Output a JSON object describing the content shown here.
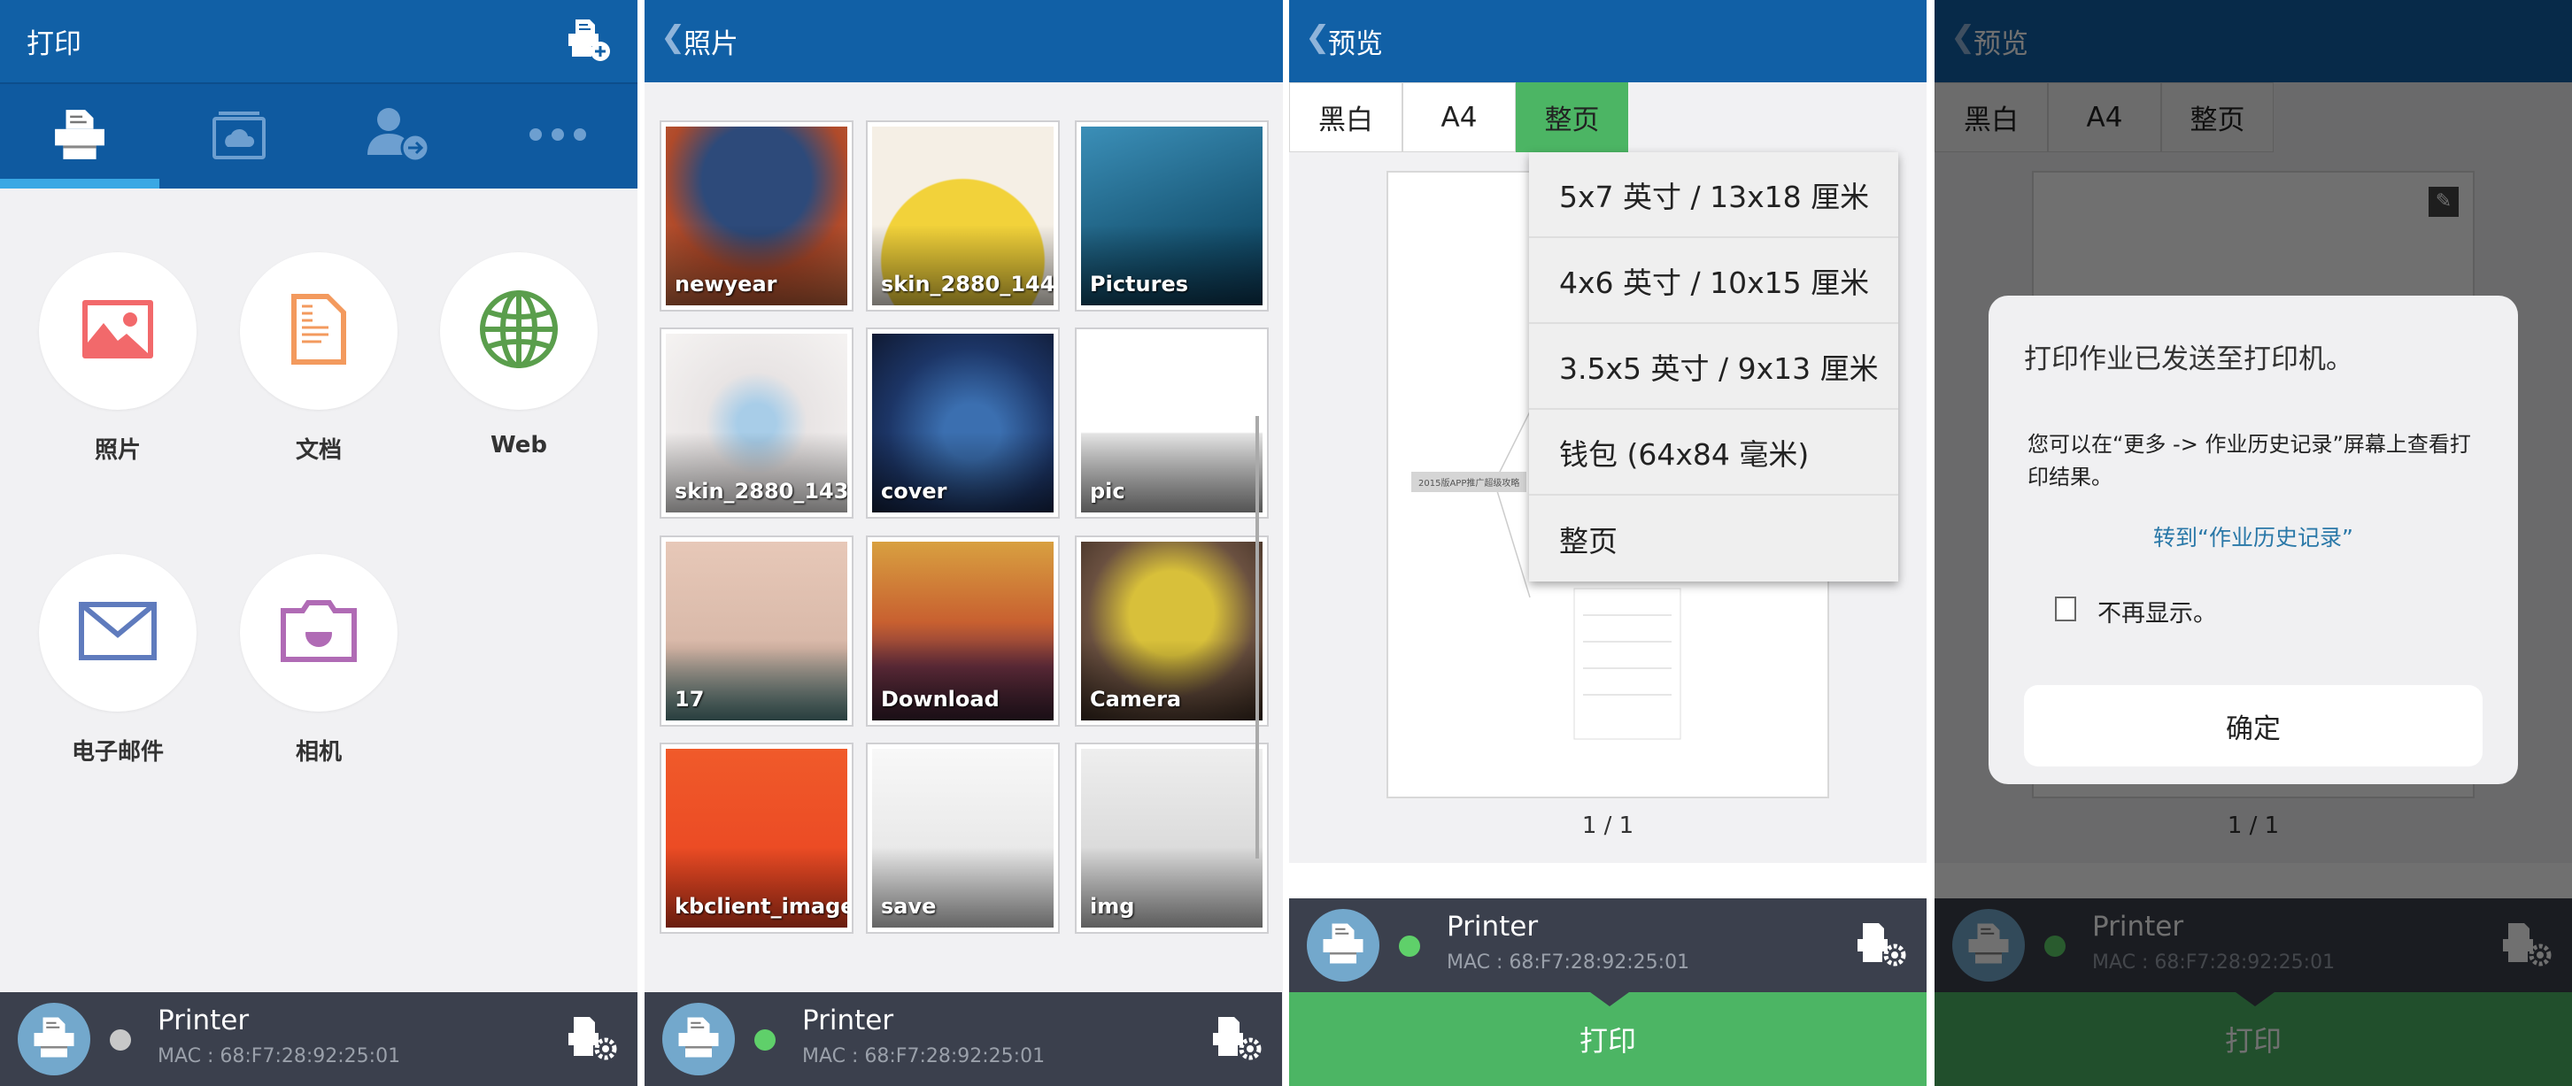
{
  "printer": {
    "name": "Printer",
    "mac": "MAC : 68:F7:28:92:25:01",
    "status_colors": {
      "offline": "#c8c8c8",
      "online": "#5fd06a"
    }
  },
  "colors": {
    "header": "#1160a6",
    "tabbar": "#0f5aa0",
    "accent": "#3aa8e4",
    "green": "#4cb564",
    "bottom": "#3b404d"
  },
  "home": {
    "title": "打印",
    "add_printer_icon": "printer-add-icon",
    "tabs": [
      {
        "icon": "printer-icon",
        "active": true
      },
      {
        "icon": "cloud-album-icon"
      },
      {
        "icon": "user-arrow-icon"
      },
      {
        "icon": "more-icon"
      }
    ],
    "sources": [
      {
        "label": "照片",
        "icon": "image-icon"
      },
      {
        "label": "文档",
        "icon": "document-icon"
      },
      {
        "label": "Web",
        "icon": "globe-icon"
      },
      {
        "label": "电子邮件",
        "icon": "mail-icon"
      },
      {
        "label": "相机",
        "icon": "camera-icon"
      }
    ]
  },
  "photos": {
    "title": "照片",
    "albums": [
      "newyear",
      "skin_2880_144...",
      "Pictures",
      "skin_2880_143...",
      "cover",
      "pic",
      "17",
      "Download",
      "Camera",
      "kbclient_image",
      "save",
      "img"
    ]
  },
  "preview": {
    "title": "预览",
    "options": {
      "color": "黑白",
      "paper": "A4",
      "size": "整页"
    },
    "size_menu": [
      "5x7 英寸 / 13x18 厘米",
      "4x6 英寸 / 10x15 厘米",
      "3.5x5 英寸 / 9x13 厘米",
      "钱包 (64x84 毫米)",
      "整页"
    ],
    "doc_label": "2015版APP推广超级攻略",
    "page_indicator": "1 / 1",
    "print_label": "打印"
  },
  "dialog": {
    "title": "打印作业已发送至打印机。",
    "message": "您可以在“更多 -> 作业历史记录”屏幕上查看打印结果。",
    "link": "转到“作业历史记录”",
    "checkbox_label": "不再显示。",
    "checkbox_checked": false,
    "ok_label": "确定"
  }
}
